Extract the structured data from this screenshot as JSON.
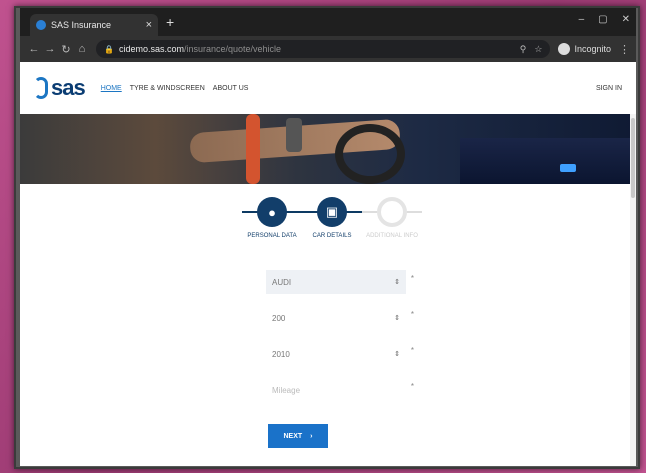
{
  "browser": {
    "tab_title": "SAS Insurance",
    "tab_close": "×",
    "new_tab": "+",
    "window_controls": [
      "–",
      "▢",
      "✕"
    ],
    "url_host": "cidemo.sas.com",
    "url_path": "/insurance/quote/vehicle",
    "incognito_label": "Incognito"
  },
  "site": {
    "logo_text": "sas",
    "nav": {
      "home": "HOME",
      "tyre": "TYRE & WINDSCREEN",
      "about": "ABOUT US"
    },
    "signin": "SIGN IN"
  },
  "steps": [
    {
      "label": "PERSONAL DATA",
      "icon": "person-icon",
      "state": "complete"
    },
    {
      "label": "CAR DETAILS",
      "icon": "car-icon",
      "state": "active"
    },
    {
      "label": "ADDITIONAL INFO",
      "icon": "circle-icon",
      "state": "pending"
    }
  ],
  "form": {
    "make": "AUDI",
    "model": "200",
    "year": "2010",
    "mileage_placeholder": "Mileage",
    "required_mark": "*",
    "select_arrow": "⇕"
  },
  "next_button": {
    "label": "NEXT",
    "chevron": "›"
  },
  "colors": {
    "accent": "#1a72c9",
    "navy": "#123e6a",
    "frame": "#b0447f"
  }
}
